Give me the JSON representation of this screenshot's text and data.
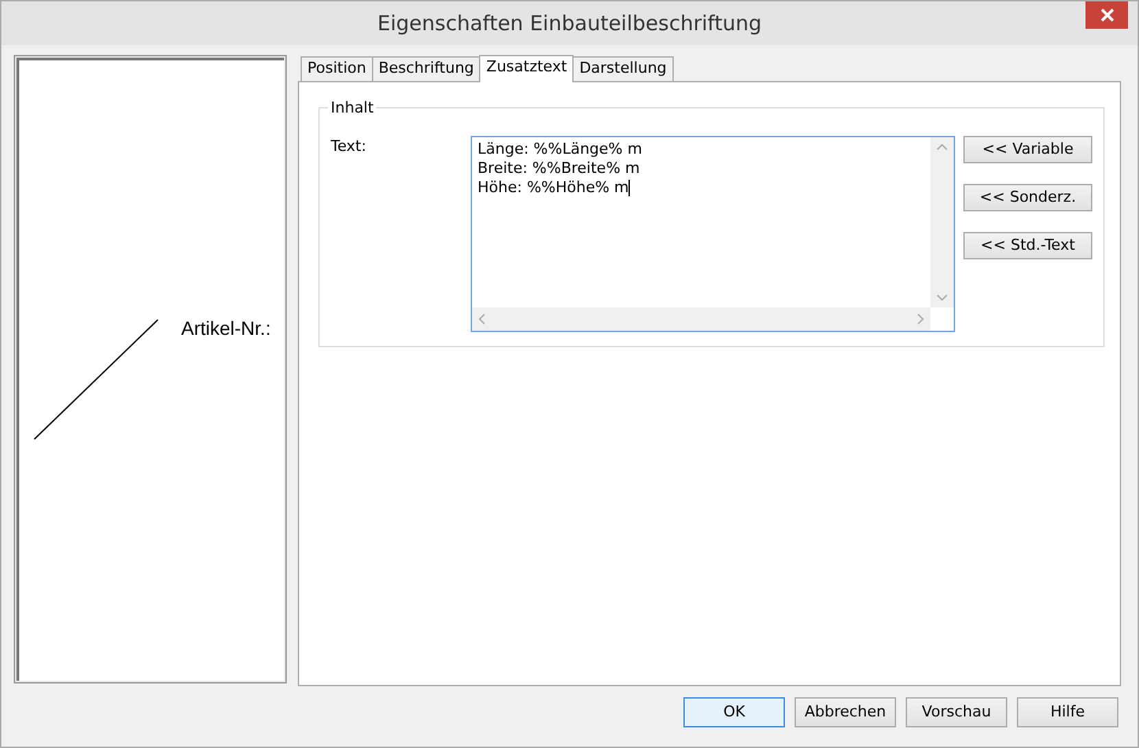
{
  "window": {
    "title": "Eigenschaften Einbauteilbeschriftung"
  },
  "preview": {
    "label": "Artikel-Nr.:"
  },
  "tabs": [
    {
      "label": "Position",
      "selected": false
    },
    {
      "label": "Beschriftung",
      "selected": false
    },
    {
      "label": "Zusatztext",
      "selected": true
    },
    {
      "label": "Darstellung",
      "selected": false
    }
  ],
  "group": {
    "title": "Inhalt",
    "field_label": "Text:",
    "text_lines": [
      "Länge: %%Länge% m",
      "Breite: %%Breite% m",
      "Höhe: %%Höhe% m"
    ]
  },
  "insert_buttons": [
    "<< Variable",
    "<< Sonderz.",
    "<< Std.-Text"
  ],
  "buttons": [
    {
      "label": "OK",
      "default": true
    },
    {
      "label": "Abbrechen",
      "default": false
    },
    {
      "label": "Vorschau",
      "default": false
    },
    {
      "label": "Hilfe",
      "default": false
    }
  ]
}
